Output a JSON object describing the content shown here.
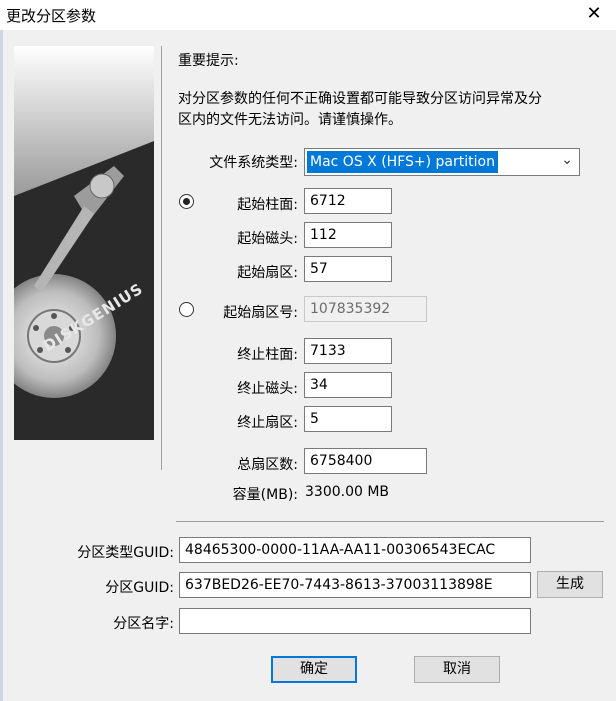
{
  "window": {
    "title": "更改分区参数",
    "close_glyph": "✕"
  },
  "notice": {
    "heading": "重要提示:",
    "line1": "对分区参数的任何不正确设置都可能导致分区访问异常及分",
    "line2": "区内的文件无法访问。请谨慎操作。"
  },
  "filesystem": {
    "label": "文件系统类型:",
    "value": "Mac OS X (HFS+) partition"
  },
  "chs_start": {
    "selected": true,
    "cylinder": {
      "label": "起始柱面:",
      "value": "6712"
    },
    "head": {
      "label": "起始磁头:",
      "value": "112"
    },
    "sector": {
      "label": "起始扇区:",
      "value": "57"
    }
  },
  "lba_start": {
    "selected": false,
    "label": "起始扇区号:",
    "value": "107835392"
  },
  "chs_end": {
    "cylinder": {
      "label": "终止柱面:",
      "value": "7133"
    },
    "head": {
      "label": "终止磁头:",
      "value": "34"
    },
    "sector": {
      "label": "终止扇区:",
      "value": "5"
    }
  },
  "total_sectors": {
    "label": "总扇区数:",
    "value": "6758400"
  },
  "capacity": {
    "label": "容量(MB):",
    "value": "3300.00 MB"
  },
  "type_guid": {
    "label": "分区类型GUID:",
    "value": "48465300-0000-11AA-AA11-00306543ECAC"
  },
  "part_guid": {
    "label": "分区GUID:",
    "value": "637BED26-EE70-7443-8613-37003113898E",
    "generate_label": "生成"
  },
  "part_name": {
    "label": "分区名字:",
    "value": ""
  },
  "buttons": {
    "ok": "确定",
    "cancel": "取消"
  },
  "art": {
    "logo_text": "DISKGENIUS",
    "icon": "hard-disk-platter"
  },
  "colors": {
    "selection": "#0078d7",
    "default_button_border": "#0078d7"
  }
}
